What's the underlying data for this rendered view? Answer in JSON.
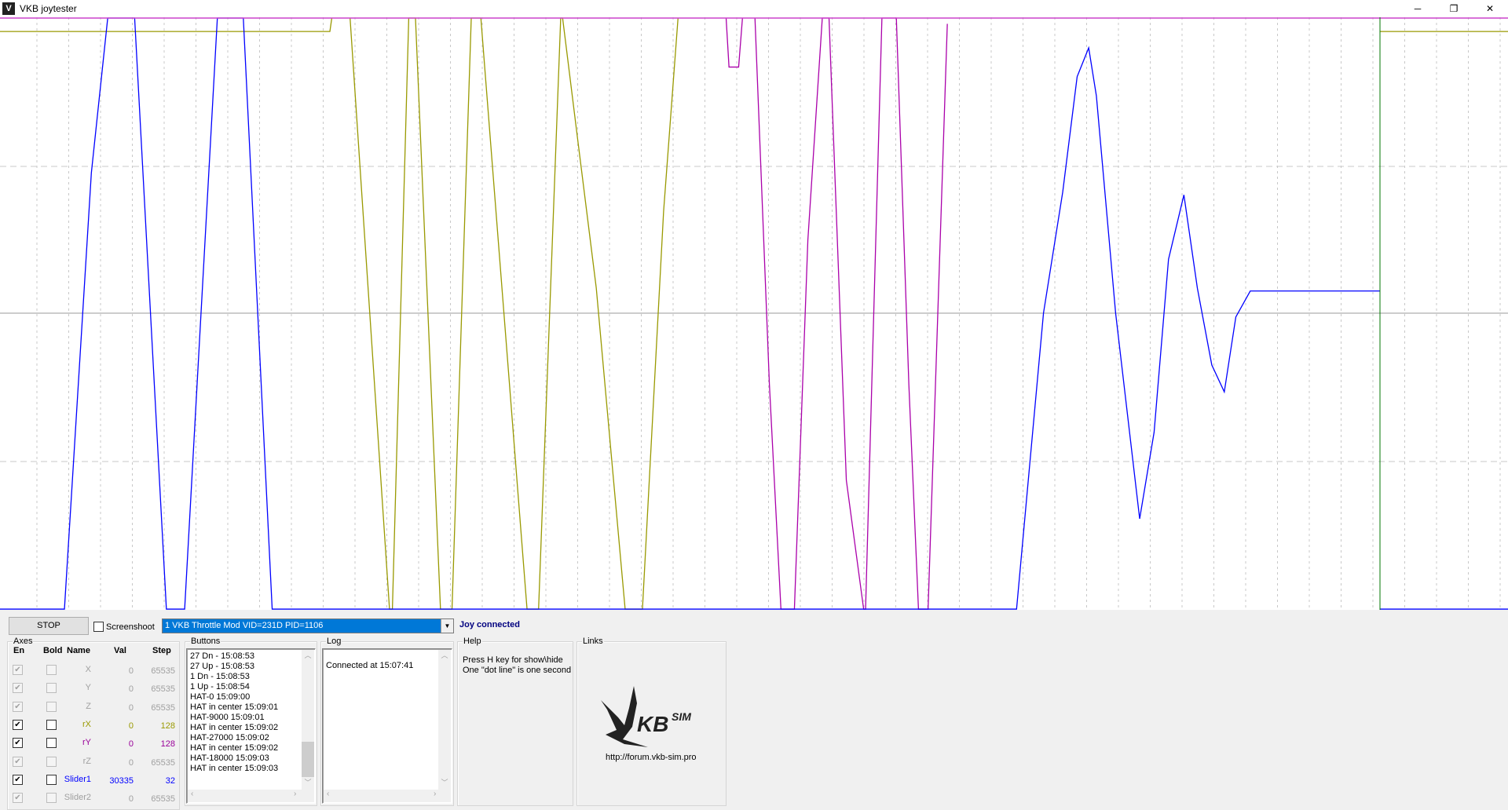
{
  "window": {
    "title": "VKB joytester",
    "icon": "vkb-app-icon",
    "minimize": "─",
    "restore": "❐",
    "close": "✕"
  },
  "plot": {
    "colors": {
      "x": "#0000ff",
      "rX": "#999900",
      "rY": "#aa00aa",
      "grid": "#c8c8c8",
      "cursor": "#007700",
      "top_line": "#cc44cc"
    }
  },
  "toolbar": {
    "stop_label": "STOP",
    "screenshot_label": "Screenshoot",
    "screenshot_checked": false,
    "device": "1 VKB Throttle Mod VID=231D PID=1106",
    "status": "Joy connected"
  },
  "axes": {
    "label": "Axes",
    "headers": {
      "en": "En",
      "bold": "Bold",
      "name": "Name",
      "val": "Val",
      "step": "Step"
    },
    "rows": [
      {
        "name": "X",
        "val": "0",
        "step": "65535",
        "enabled": true,
        "disabled": true,
        "color": "#a0a0a0"
      },
      {
        "name": "Y",
        "val": "0",
        "step": "65535",
        "enabled": true,
        "disabled": true,
        "color": "#a0a0a0"
      },
      {
        "name": "Z",
        "val": "0",
        "step": "65535",
        "enabled": true,
        "disabled": true,
        "color": "#a0a0a0"
      },
      {
        "name": "rX",
        "val": "0",
        "step": "128",
        "enabled": true,
        "disabled": false,
        "color": "#999900"
      },
      {
        "name": "rY",
        "val": "0",
        "step": "128",
        "enabled": true,
        "disabled": false,
        "color": "#990099"
      },
      {
        "name": "rZ",
        "val": "0",
        "step": "65535",
        "enabled": true,
        "disabled": true,
        "color": "#a0a0a0"
      },
      {
        "name": "Slider1",
        "val": "30335",
        "step": "32",
        "enabled": true,
        "disabled": false,
        "color": "#0000ff"
      },
      {
        "name": "Slider2",
        "val": "0",
        "step": "65535",
        "enabled": true,
        "disabled": true,
        "color": "#a0a0a0"
      }
    ]
  },
  "buttons": {
    "label": "Buttons",
    "lines": [
      "27 Dn - 15:08:53",
      "27 Up - 15:08:53",
      "1 Dn - 15:08:53",
      "1 Up - 15:08:54",
      "HAT-0 15:09:00",
      "HAT in center 15:09:01",
      "HAT-9000 15:09:01",
      "HAT in center 15:09:02",
      "HAT-27000 15:09:02",
      "HAT in center 15:09:02",
      "HAT-18000 15:09:03",
      "HAT in center 15:09:03"
    ]
  },
  "log": {
    "label": "Log",
    "lines": [
      "Connected at 15:07:41"
    ]
  },
  "help": {
    "label": "Help",
    "lines": [
      "Press H key for show\\hide",
      "One \"dot line\" is one second"
    ]
  },
  "links": {
    "label": "Links",
    "logo_text": "VKBSIM",
    "url": "http://forum.vkb-sim.pro"
  }
}
